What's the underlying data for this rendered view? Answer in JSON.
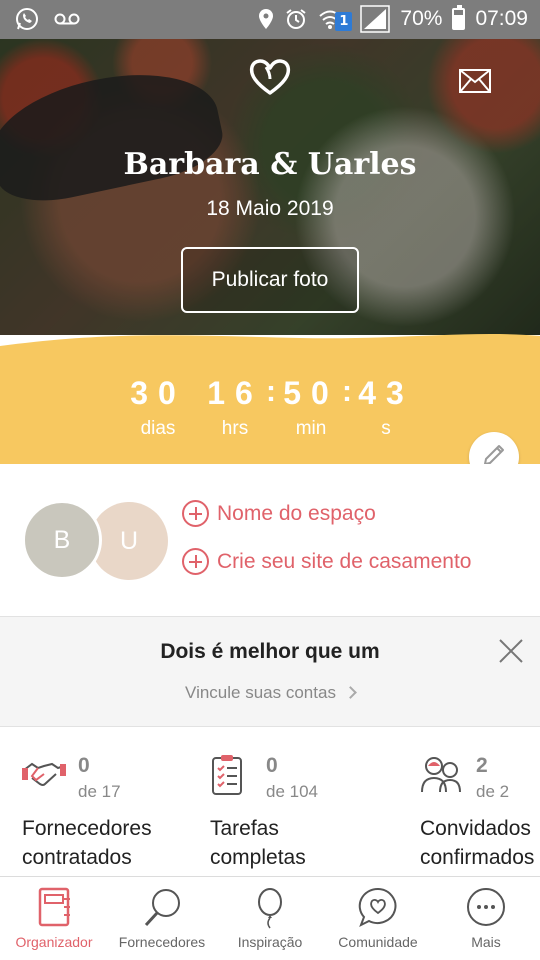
{
  "status_bar": {
    "battery": "70%",
    "battery_level": 0.7,
    "time": "07:09",
    "sim_badge": "1",
    "icons": [
      "whatsapp-icon",
      "voicemail-icon",
      "location-icon",
      "alarm-icon",
      "wifi-icon",
      "signal-icon",
      "battery-icon"
    ]
  },
  "hero": {
    "couple_name": "Barbara & Uarles",
    "date": "18 Maio 2019",
    "publish_button": "Publicar foto",
    "icons": [
      "heart-logo-icon",
      "mail-icon"
    ]
  },
  "countdown": {
    "days": "30",
    "days_label": "dias",
    "hours": "16",
    "hours_label": "hrs",
    "minutes": "50",
    "minutes_label": "min",
    "seconds": "43",
    "seconds_label": "s",
    "separator": ":",
    "background_color": "#f7c860"
  },
  "profile": {
    "avatar_1": "B",
    "avatar_2": "U",
    "link_venue": "Nome do espaço",
    "link_website": "Crie seu site de casamento"
  },
  "promo": {
    "title": "Dois é melhor que um",
    "link": "Vincule suas contas"
  },
  "stats": [
    {
      "count": "0",
      "of": "de 17",
      "label": "Fornecedores contratados",
      "icon": "handshake-icon"
    },
    {
      "count": "0",
      "of": "de 104",
      "label": "Tarefas completas",
      "icon": "checklist-icon"
    },
    {
      "count": "2",
      "of": "de 2",
      "label": "Convidados confirmados",
      "icon": "guests-icon"
    }
  ],
  "bottom_nav": [
    {
      "label": "Organizador",
      "icon": "notebook-icon",
      "active": true
    },
    {
      "label": "Fornecedores",
      "icon": "magnifier-icon",
      "active": false
    },
    {
      "label": "Inspiração",
      "icon": "balloon-icon",
      "active": false
    },
    {
      "label": "Comunidade",
      "icon": "chat-heart-icon",
      "active": false
    },
    {
      "label": "Mais",
      "icon": "more-icon",
      "active": false
    }
  ],
  "colors": {
    "accent": "#e0626a",
    "countdown_bg": "#f7c860",
    "text_muted": "#888888"
  }
}
